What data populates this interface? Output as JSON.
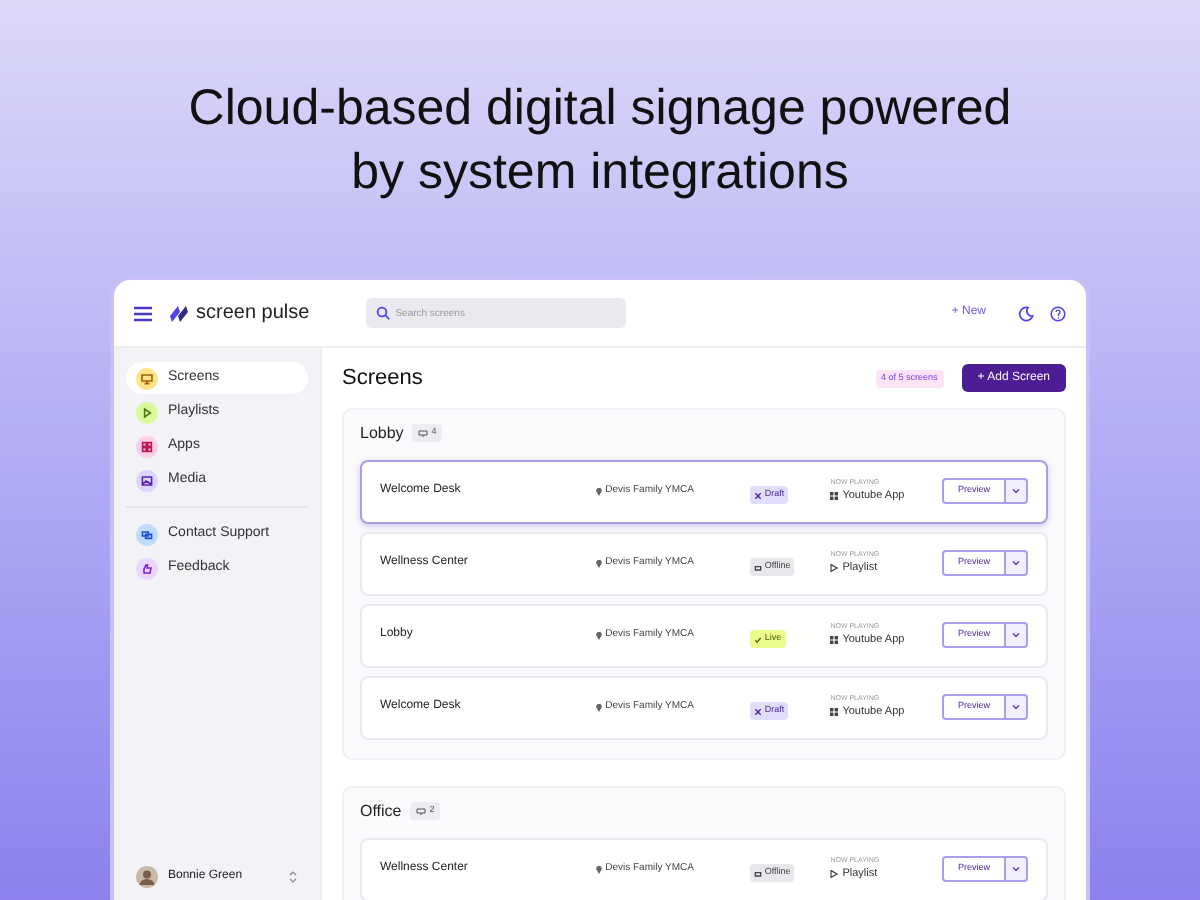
{
  "headline": "Cloud-based digital signage powered by system integrations",
  "app": {
    "brand": "screen pulse",
    "search": {
      "placeholder": "Search screens"
    },
    "new_button": "+ New",
    "sidebar": {
      "items": [
        {
          "label": "Screens",
          "kind": "screens",
          "selected": true
        },
        {
          "label": "Playlists",
          "kind": "playlists",
          "selected": false
        },
        {
          "label": "Apps",
          "kind": "apps",
          "selected": false
        },
        {
          "label": "Media",
          "kind": "media",
          "selected": false
        }
      ],
      "support_items": [
        {
          "label": "Contact Support",
          "kind": "support"
        },
        {
          "label": "Feedback",
          "kind": "feedback"
        }
      ],
      "user": "Bonnie Green"
    },
    "page_title": "Screens",
    "quota": "4 of 5 screens",
    "add_button": "+ Add Screen",
    "groups": [
      {
        "name": "Lobby",
        "count": "4",
        "screens": [
          {
            "name": "Welcome Desk",
            "location": "Devis Family YMCA",
            "status": {
              "label": "Draft",
              "kind": "draft"
            },
            "now_playing": {
              "label": "NOW PLAYING",
              "title": "Youtube App",
              "kind": "app"
            },
            "preview": "Preview",
            "selected": true
          },
          {
            "name": "Wellness Center",
            "location": "Devis Family YMCA",
            "status": {
              "label": "Offline",
              "kind": "offline"
            },
            "now_playing": {
              "label": "NOW PLAYING",
              "title": "Playlist",
              "kind": "playlist"
            },
            "preview": "Preview",
            "selected": false
          },
          {
            "name": "Lobby",
            "location": "Devis Family YMCA",
            "status": {
              "label": "Live",
              "kind": "live"
            },
            "now_playing": {
              "label": "NOW PLAYING",
              "title": "Youtube App",
              "kind": "app"
            },
            "preview": "Preview",
            "selected": false
          },
          {
            "name": "Welcome Desk",
            "location": "Devis Family YMCA",
            "status": {
              "label": "Draft",
              "kind": "draft"
            },
            "now_playing": {
              "label": "NOW PLAYING",
              "title": "Youtube App",
              "kind": "app"
            },
            "preview": "Preview",
            "selected": false
          }
        ]
      },
      {
        "name": "Office",
        "count": "2",
        "screens": [
          {
            "name": "Wellness Center",
            "location": "Devis Family YMCA",
            "status": {
              "label": "Offline",
              "kind": "offline"
            },
            "now_playing": {
              "label": "NOW PLAYING",
              "title": "Playlist",
              "kind": "playlist"
            },
            "preview": "Preview",
            "selected": false
          }
        ]
      }
    ]
  }
}
